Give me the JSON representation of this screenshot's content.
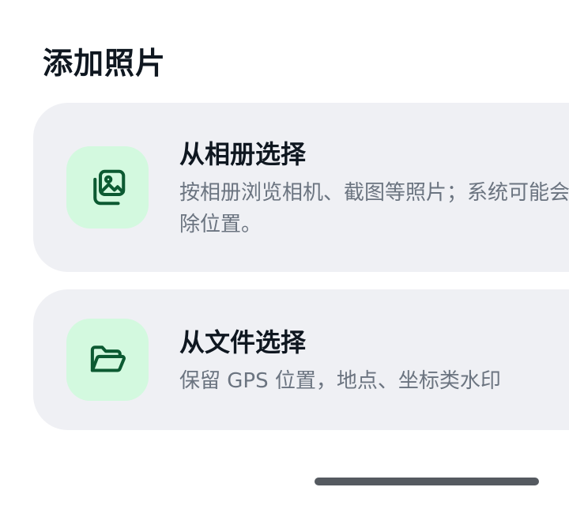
{
  "sheet": {
    "title": "添加照片"
  },
  "options": [
    {
      "title": "从相册选择",
      "description": "按相册浏览相机、截图等照片；系统可能会移除位置。",
      "icon": "gallery-icon"
    },
    {
      "title": "从文件选择",
      "description": "保留 GPS 位置，地点、坐标类水印",
      "icon": "folder-open-icon"
    }
  ],
  "colors": {
    "card_background": "#eff0f4",
    "icon_tile": "#d3f9df",
    "icon_stroke": "#0c5a32",
    "title_text": "#0f1720",
    "description_text": "#6b7480"
  }
}
